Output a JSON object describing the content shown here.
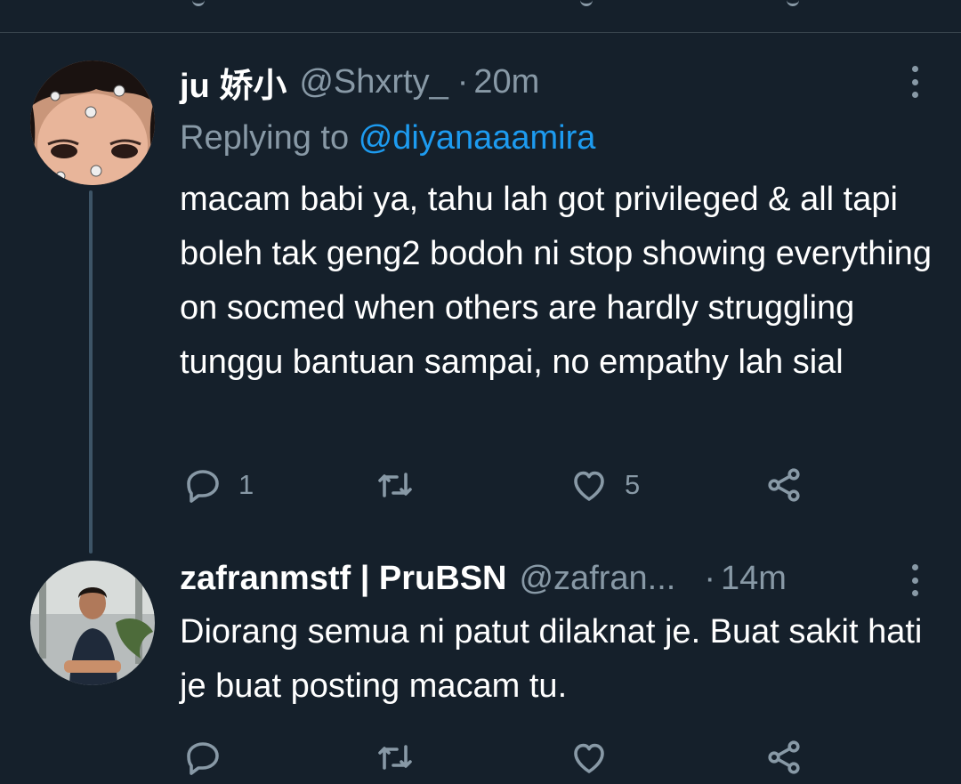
{
  "tweets": [
    {
      "display_name": "ju 娇小",
      "handle": "@Shxrty_",
      "separator": "·",
      "time": "20m",
      "replying_prefix": "Replying to",
      "replying_to": "@diyanaaamira",
      "text": "macam babi ya, tahu lah got privileged & all tapi boleh tak geng2 bodoh ni stop showing everything on socmed when others are hardly struggling tunggu bantuan sampai, no empathy lah sial",
      "reply_count": "1",
      "retweet_count": "",
      "like_count": "5"
    },
    {
      "display_name": "zafranmstf | PruBSN",
      "handle": "@zafran...",
      "separator": "·",
      "time": "14m",
      "text": "Diorang semua ni patut dilaknat je. Buat sakit hati je buat posting macam tu.",
      "reply_count": "",
      "retweet_count": "",
      "like_count": ""
    }
  ],
  "icons": [
    "reply-icon",
    "retweet-icon",
    "like-icon",
    "share-icon",
    "more-icon"
  ],
  "colors": {
    "background": "#15202b",
    "text": "#ffffff",
    "secondary": "#8899a6",
    "link": "#1d9bf0",
    "divider": "#38444d",
    "thread_line": "#3d5466"
  }
}
